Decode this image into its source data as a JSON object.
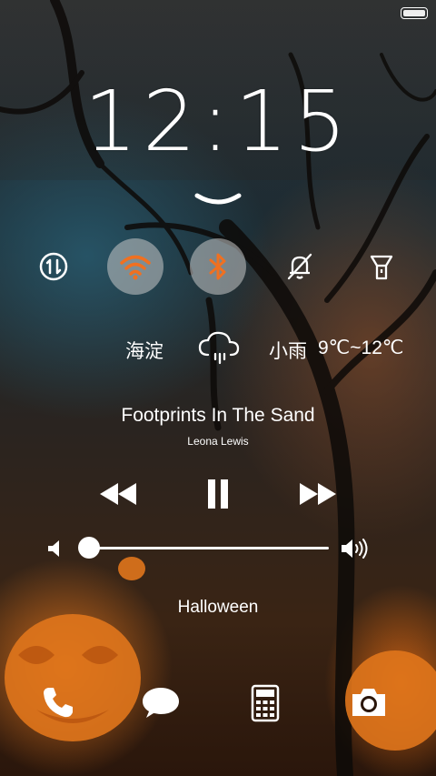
{
  "status_bar": {
    "battery_icon": "battery-icon",
    "battery_level": 1.0
  },
  "clock": {
    "hours": "12",
    "separator": ":",
    "minutes": "15"
  },
  "pull_handle": {
    "icon": "chevron-down-icon"
  },
  "quick_toggles": [
    {
      "name": "mobile-data",
      "icon": "data-arrows-icon",
      "active": false
    },
    {
      "name": "wifi",
      "icon": "wifi-icon",
      "active": true
    },
    {
      "name": "bluetooth",
      "icon": "bluetooth-icon",
      "active": true
    },
    {
      "name": "silent",
      "icon": "bell-muted-icon",
      "active": false
    },
    {
      "name": "flashlight",
      "icon": "flashlight-icon",
      "active": false
    }
  ],
  "weather": {
    "city": "海淀",
    "icon": "rain-cloud-icon",
    "condition": "小雨",
    "temperature": "9℃~12℃"
  },
  "music": {
    "title": "Footprints In The Sand",
    "artist": "Leona Lewis",
    "controls": [
      "rewind-icon",
      "pause-icon",
      "fast-forward-icon"
    ],
    "volume": 0.0
  },
  "caption": "Halloween",
  "dock": [
    "phone-icon",
    "message-icon",
    "calculator-icon",
    "camera-icon"
  ],
  "colors": {
    "accent": "#f07020",
    "toggle_on_bg": "#c8c8c8",
    "text": "#ffffff"
  }
}
